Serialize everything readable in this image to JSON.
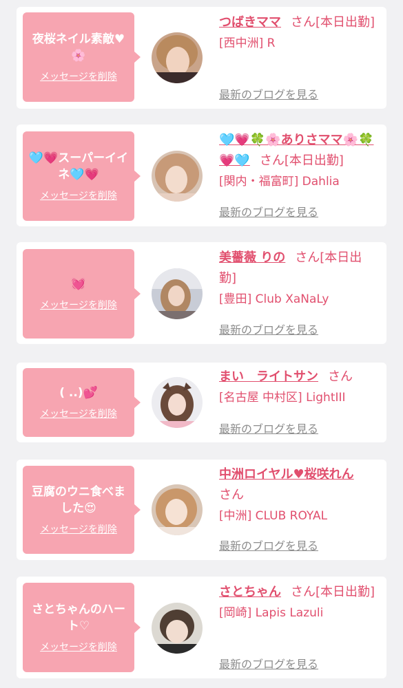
{
  "colors": {
    "background": "#f1f1f3",
    "bubble": "#f7a5b1",
    "accent": "#e14f6e",
    "blog_link": "#8c8c8c"
  },
  "items": [
    {
      "message": "夜桜ネイル素敵♥🌸",
      "delete_label": "メッセージを削除",
      "name": "つばきママ",
      "san": "さん",
      "status": "[本日出勤]",
      "location": "[西中洲] R",
      "blog_link": "最新のブログを見る"
    },
    {
      "message": "🩵💗スーパーイイネ🩵💗",
      "delete_label": "メッセージを削除",
      "name": "🩵💗🍀🌸ありさママ🌸🍀💗🩵",
      "san": "さん",
      "status": "[本日出勤]",
      "location": "[関内・福富町] Dahlia",
      "blog_link": "最新のブログを見る"
    },
    {
      "message": "💓",
      "delete_label": "メッセージを削除",
      "name": "美薔薇 りの",
      "san": "さん",
      "status": "[本日出勤]",
      "location": "[豊田] Club XaNaLy",
      "blog_link": "最新のブログを見る"
    },
    {
      "message": "( ..)💕",
      "delete_label": "メッセージを削除",
      "name": "まい　ライトサン",
      "san": "さん",
      "status": "",
      "location": "[名古屋 中村区] LightIII",
      "blog_link": "最新のブログを見る"
    },
    {
      "message": "豆腐のウニ食べました😍",
      "delete_label": "メッセージを削除",
      "name": "中洲ロイヤル♥桜咲れん",
      "san": "さん",
      "status": "",
      "location": "[中洲] CLUB ROYAL",
      "blog_link": "最新のブログを見る"
    },
    {
      "message": "さとちゃんのハート♡",
      "delete_label": "メッセージを削除",
      "name": "さとちゃん",
      "san": "さん",
      "status": "[本日出勤]",
      "location": "[岡崎] Lapis Lazuli",
      "blog_link": "最新のブログを見る"
    }
  ]
}
